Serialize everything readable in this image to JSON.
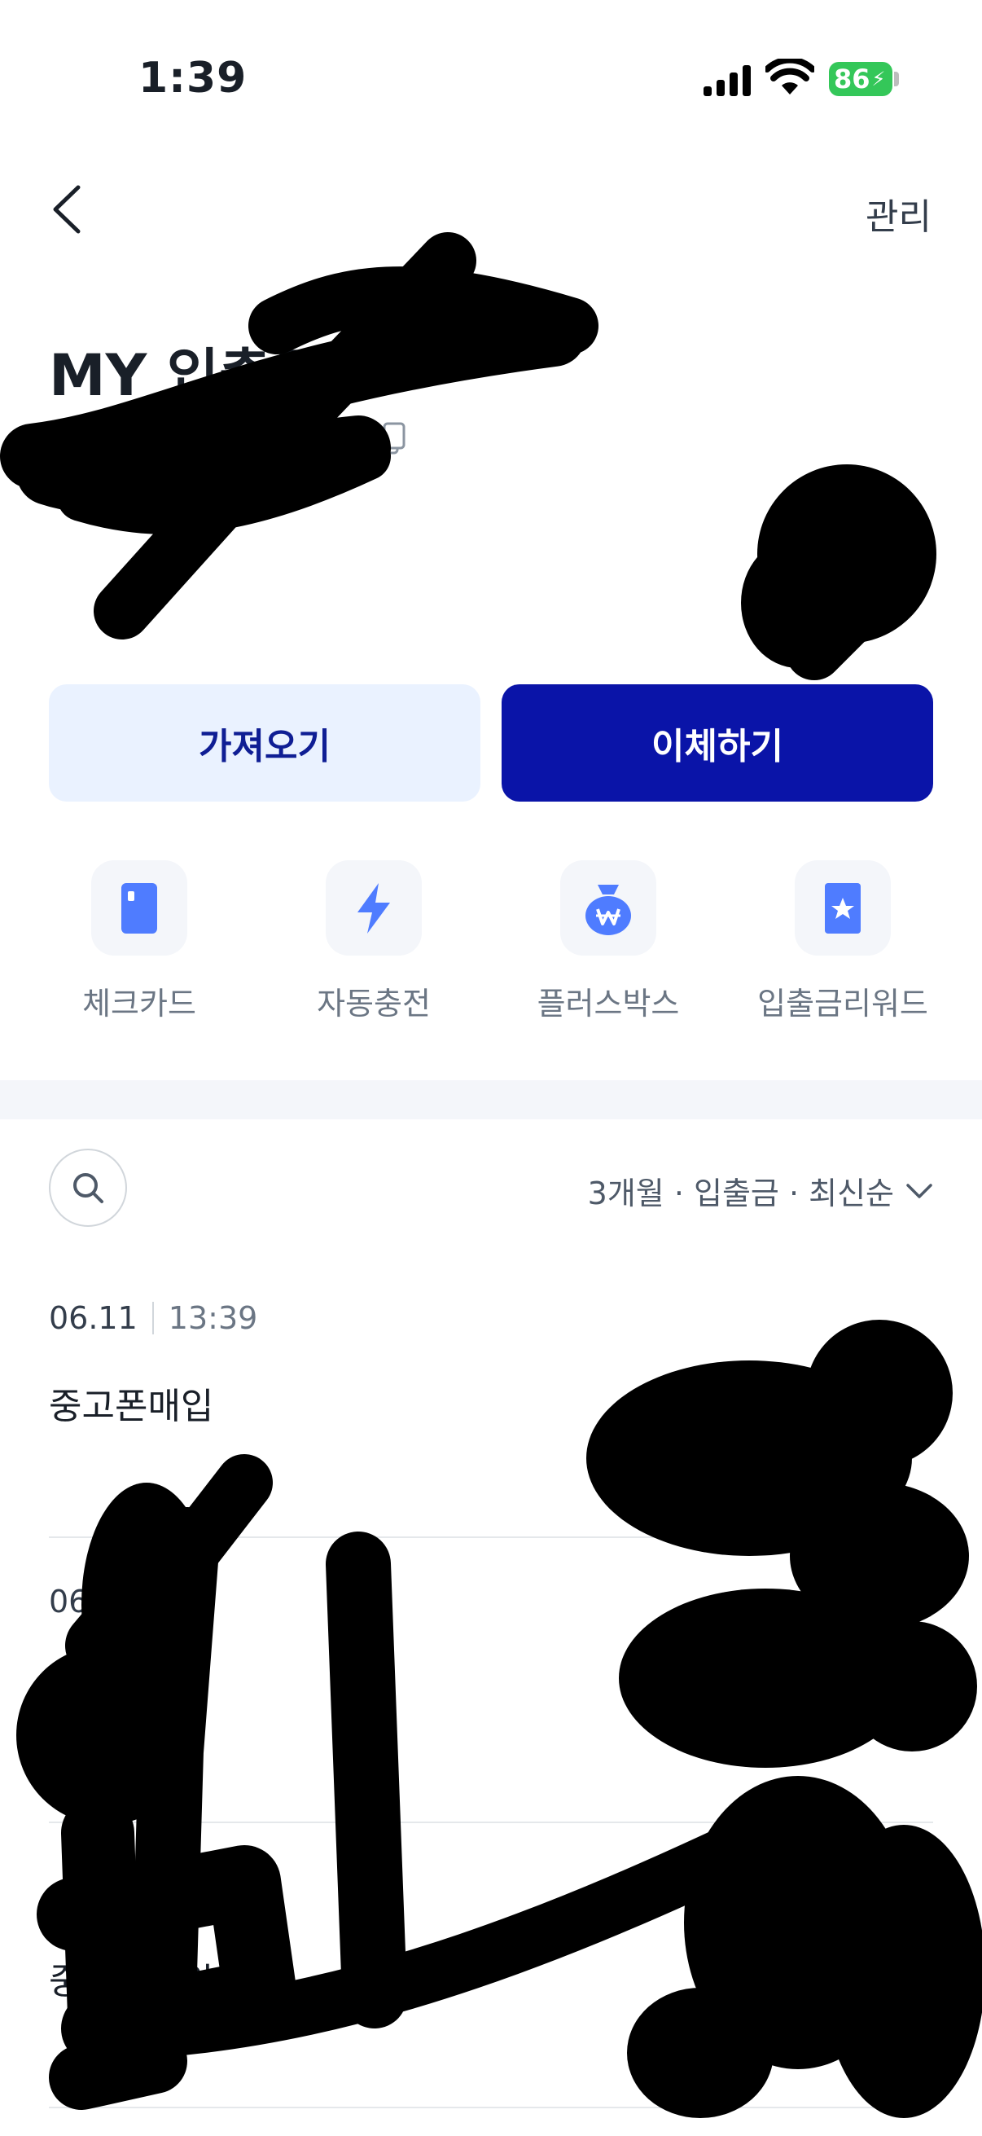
{
  "status_bar": {
    "time": "1:39",
    "battery": "86"
  },
  "nav": {
    "manage_label": "관리"
  },
  "account": {
    "title": "MY 입출금"
  },
  "actions": {
    "bring_label": "가져오기",
    "transfer_label": "이체하기"
  },
  "quick_menu": [
    {
      "label": "체크카드",
      "icon": "card-icon"
    },
    {
      "label": "자동충전",
      "icon": "lightning-icon"
    },
    {
      "label": "플러스박스",
      "icon": "money-bag-icon"
    },
    {
      "label": "입출금리워드",
      "icon": "star-badge-icon"
    }
  ],
  "filter": {
    "label": "3개월 · 입출금 · 최신순"
  },
  "transactions": [
    {
      "date": "06.11",
      "time": "13:39",
      "name": "중고폰매입"
    },
    {
      "date": "06",
      "time": "",
      "name": ""
    },
    {
      "date": "",
      "time": "",
      "name": "중고폰매입"
    }
  ],
  "colors": {
    "primary": "#0a14a8",
    "primary_light": "#eaf2ff",
    "icon_blue": "#4f7cff"
  }
}
